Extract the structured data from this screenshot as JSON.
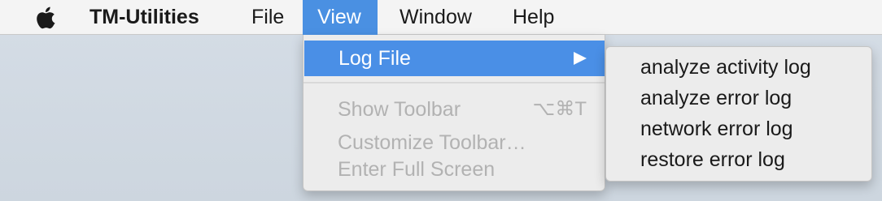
{
  "menubar": {
    "app_name": "TM-Utilities",
    "menus": [
      "File",
      "View",
      "Window",
      "Help"
    ]
  },
  "view_menu": {
    "items": [
      {
        "label": "Log File",
        "highlighted": true,
        "has_submenu": true,
        "icon": "chevron-right-icon"
      },
      {
        "label": "Show Toolbar",
        "shortcut": "⌥⌘T",
        "disabled": true
      },
      {
        "label": "Customize Toolbar…",
        "disabled": true
      },
      {
        "label": "Enter Full Screen",
        "disabled": true
      }
    ]
  },
  "log_file_submenu": {
    "items": [
      "analyze activity log",
      "analyze error log",
      "network error log",
      "restore error log"
    ]
  },
  "colors": {
    "highlight": "#4a8fe6",
    "menubar": "#f4f4f4",
    "menu_bg": "#ececec",
    "disabled_text": "#b2b2b2"
  }
}
